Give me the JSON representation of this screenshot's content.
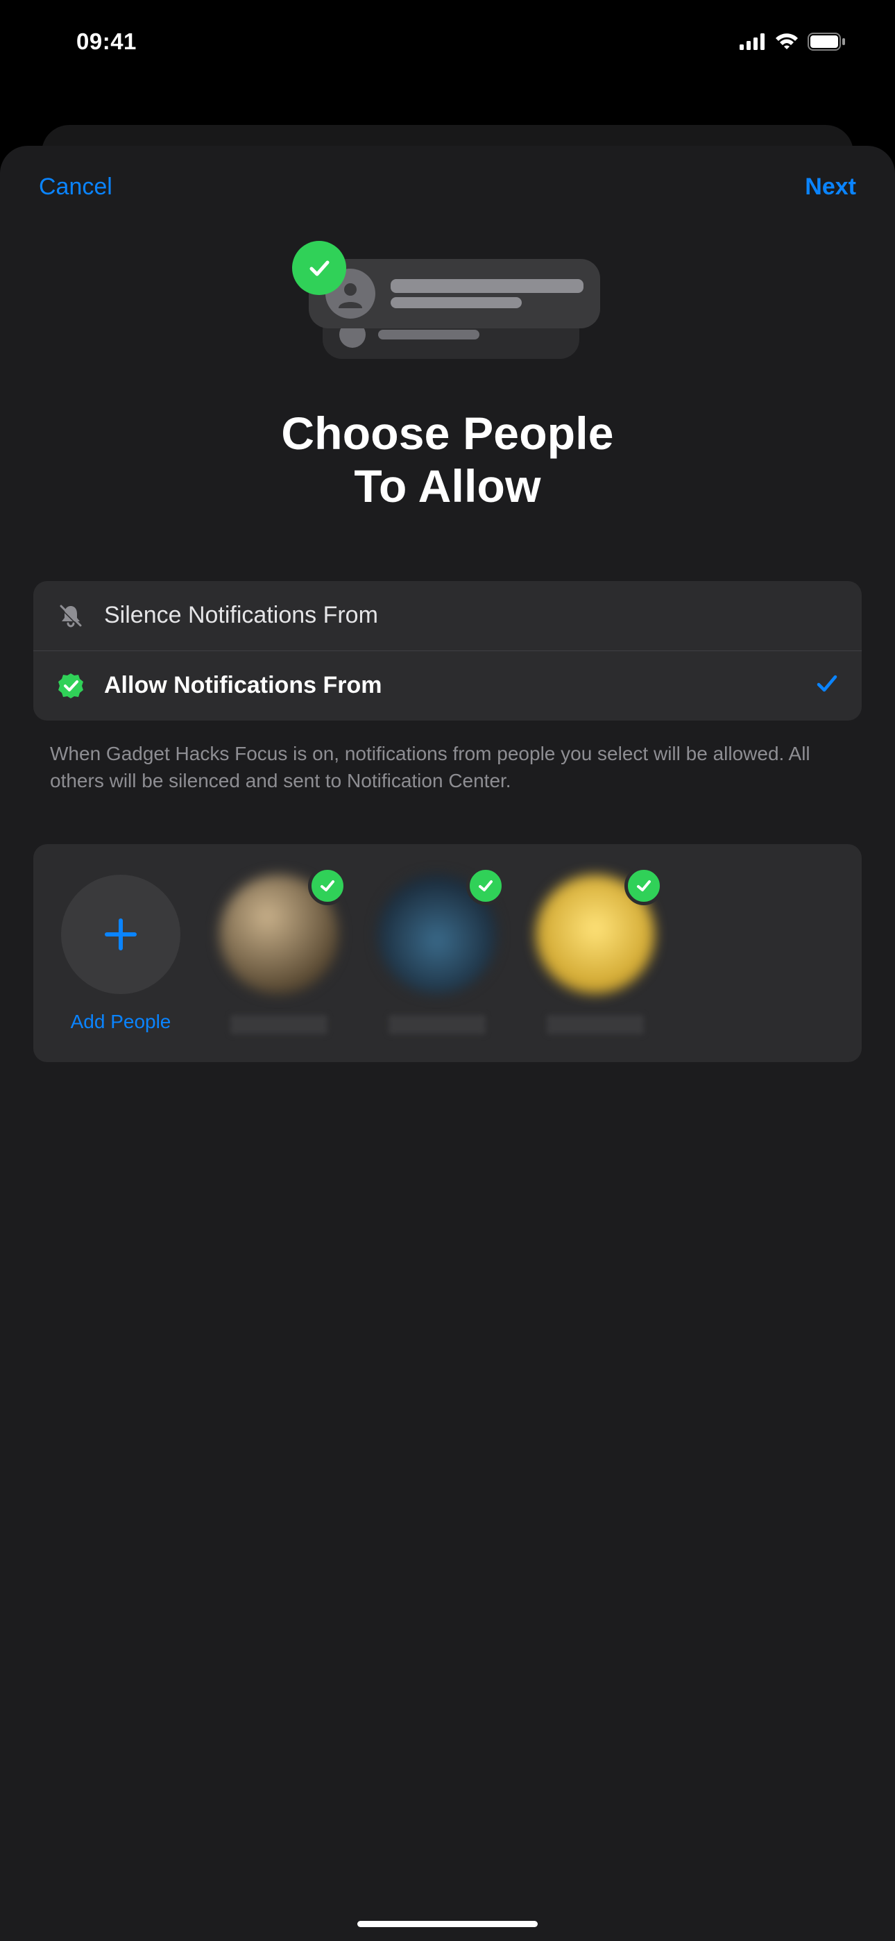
{
  "status": {
    "time": "09:41"
  },
  "nav": {
    "cancel": "Cancel",
    "next": "Next"
  },
  "hero": {
    "title_line1": "Choose People",
    "title_line2": "To Allow"
  },
  "options": {
    "silence": {
      "label": "Silence Notifications From",
      "icon": "bell-slash-icon"
    },
    "allow": {
      "label": "Allow Notifications From",
      "icon": "checkmark-seal-icon",
      "selected": true
    }
  },
  "help": "When Gadget Hacks Focus is on, notifications from people you select will be allowed. All others will be silenced and sent to Notification Center.",
  "people": {
    "add_label": "Add People",
    "contacts": [
      {
        "id": "contact-1",
        "checked": true
      },
      {
        "id": "contact-2",
        "checked": true
      },
      {
        "id": "contact-3",
        "checked": true
      }
    ]
  },
  "colors": {
    "accent": "#0a84ff",
    "success": "#30d158"
  }
}
